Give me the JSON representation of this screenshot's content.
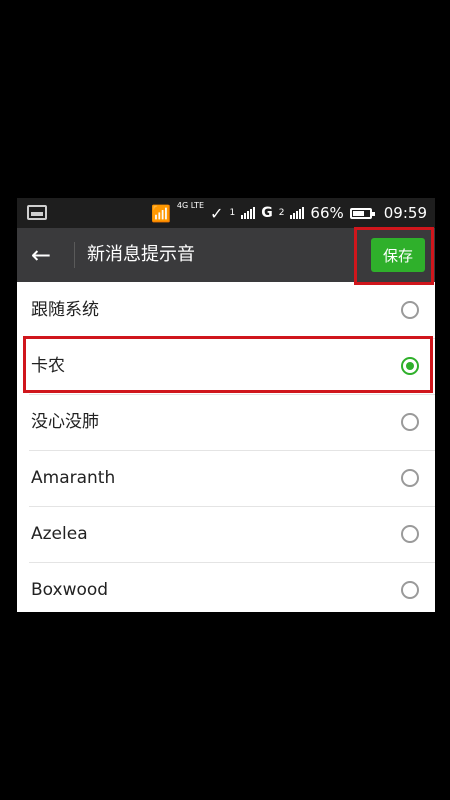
{
  "status_bar": {
    "network_type": "4G LTE",
    "signal_1": "1",
    "carrier_type": "G",
    "signal_2": "2",
    "battery_percent": "66%",
    "time": "09:59"
  },
  "header": {
    "title": "新消息提示音",
    "save_label": "保存"
  },
  "ringtones": [
    {
      "label": "跟随系统",
      "selected": false
    },
    {
      "label": "卡农",
      "selected": true
    },
    {
      "label": "没心没肺",
      "selected": false
    },
    {
      "label": "Amaranth",
      "selected": false
    },
    {
      "label": "Azelea",
      "selected": false
    },
    {
      "label": "Boxwood",
      "selected": false
    }
  ],
  "colors": {
    "accent": "#2fb02b",
    "highlight_box": "#d0161c",
    "action_bar": "#3a3a3c"
  }
}
